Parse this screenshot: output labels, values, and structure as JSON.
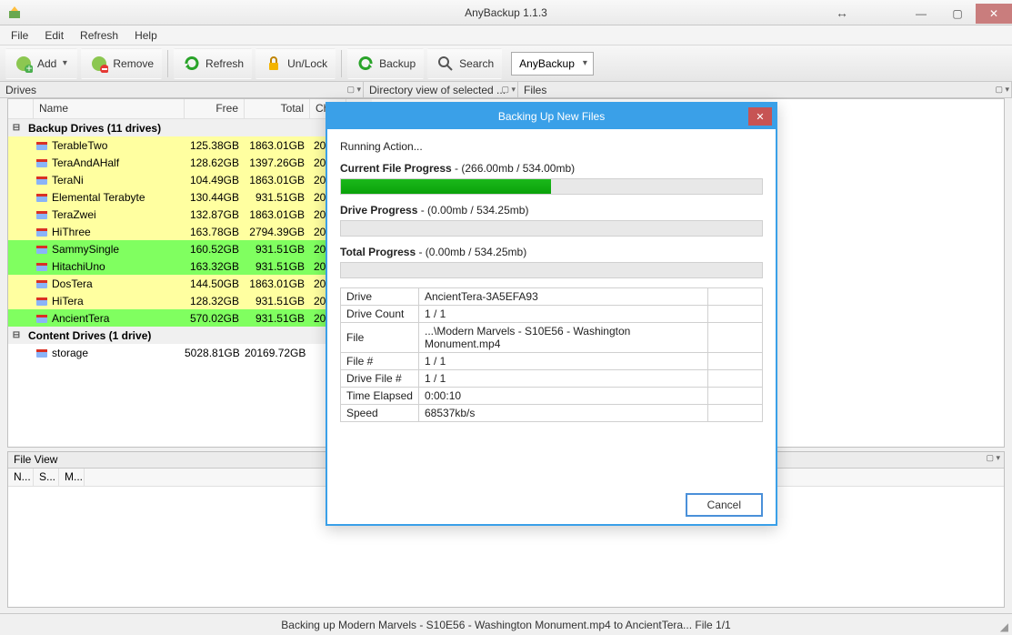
{
  "window": {
    "title": "AnyBackup 1.1.3"
  },
  "menu": {
    "file": "File",
    "edit": "Edit",
    "refresh": "Refresh",
    "help": "Help"
  },
  "toolbar": {
    "add": "Add",
    "remove": "Remove",
    "refresh": "Refresh",
    "unlock": "Un/Lock",
    "backup": "Backup",
    "search": "Search",
    "combo": "AnyBackup"
  },
  "panels": {
    "drives": "Drives",
    "dirview": "Directory view of selected ...",
    "files": "Files"
  },
  "cols": {
    "name": "Name",
    "free": "Free",
    "total": "Total",
    "chk": "Chk..."
  },
  "groups": {
    "backup": "Backup Drives (11 drives)",
    "content": "Content Drives (1 drive)"
  },
  "drives": [
    {
      "name": "TerableTwo",
      "free": "125.38GB",
      "total": "1863.01GB",
      "chk": "2014",
      "color": "yellow"
    },
    {
      "name": "TeraAndAHalf",
      "free": "128.62GB",
      "total": "1397.26GB",
      "chk": "2014",
      "color": "yellow"
    },
    {
      "name": "TeraNi",
      "free": "104.49GB",
      "total": "1863.01GB",
      "chk": "2014",
      "color": "yellow"
    },
    {
      "name": "Elemental Terabyte",
      "free": "130.44GB",
      "total": "931.51GB",
      "chk": "2014",
      "color": "yellow"
    },
    {
      "name": "TeraZwei",
      "free": "132.87GB",
      "total": "1863.01GB",
      "chk": "2014",
      "color": "yellow"
    },
    {
      "name": "HiThree",
      "free": "163.78GB",
      "total": "2794.39GB",
      "chk": "2014",
      "color": "yellow"
    },
    {
      "name": "SammySingle",
      "free": "160.52GB",
      "total": "931.51GB",
      "chk": "2014",
      "color": "green"
    },
    {
      "name": "HitachiUno",
      "free": "163.32GB",
      "total": "931.51GB",
      "chk": "2014",
      "color": "green"
    },
    {
      "name": "DosTera",
      "free": "144.50GB",
      "total": "1863.01GB",
      "chk": "2014",
      "color": "yellow"
    },
    {
      "name": "HiTera",
      "free": "128.32GB",
      "total": "931.51GB",
      "chk": "2014",
      "color": "yellow"
    },
    {
      "name": "AncientTera",
      "free": "570.02GB",
      "total": "931.51GB",
      "chk": "2014",
      "color": "green"
    }
  ],
  "content_drives": [
    {
      "name": "storage",
      "free": "5028.81GB",
      "total": "20169.72GB",
      "chk": "",
      "color": "white"
    }
  ],
  "fileview": {
    "title": "File View",
    "c1": "N...",
    "c2": "S...",
    "c3": "M..."
  },
  "status": {
    "text": "Backing up Modern Marvels - S10E56 - Washington Monument.mp4 to AncientTera... File 1/1"
  },
  "dialog": {
    "title": "Backing Up New Files",
    "running": "Running Action...",
    "cur_label": "Current File Progress",
    "cur_sub": " - (266.00mb / 534.00mb)",
    "cur_pct": 49.8,
    "drv_label": "Drive Progress",
    "drv_sub": " - (0.00mb / 534.25mb)",
    "drv_pct": 0,
    "tot_label": "Total Progress",
    "tot_sub": " - (0.00mb / 534.25mb)",
    "tot_pct": 0,
    "info": {
      "drive_k": "Drive",
      "drive_v": "AncientTera-3A5EFA93",
      "drivecount_k": "Drive Count",
      "drivecount_v": "1 / 1",
      "file_k": "File",
      "file_v": "...\\Modern Marvels - S10E56 - Washington Monument.mp4",
      "filenum_k": "File #",
      "filenum_v": "1 / 1",
      "drivefile_k": "Drive File #",
      "drivefile_v": "1 / 1",
      "elapsed_k": "Time Elapsed",
      "elapsed_v": "0:00:10",
      "speed_k": "Speed",
      "speed_v": "68537kb/s"
    },
    "cancel": "Cancel"
  }
}
